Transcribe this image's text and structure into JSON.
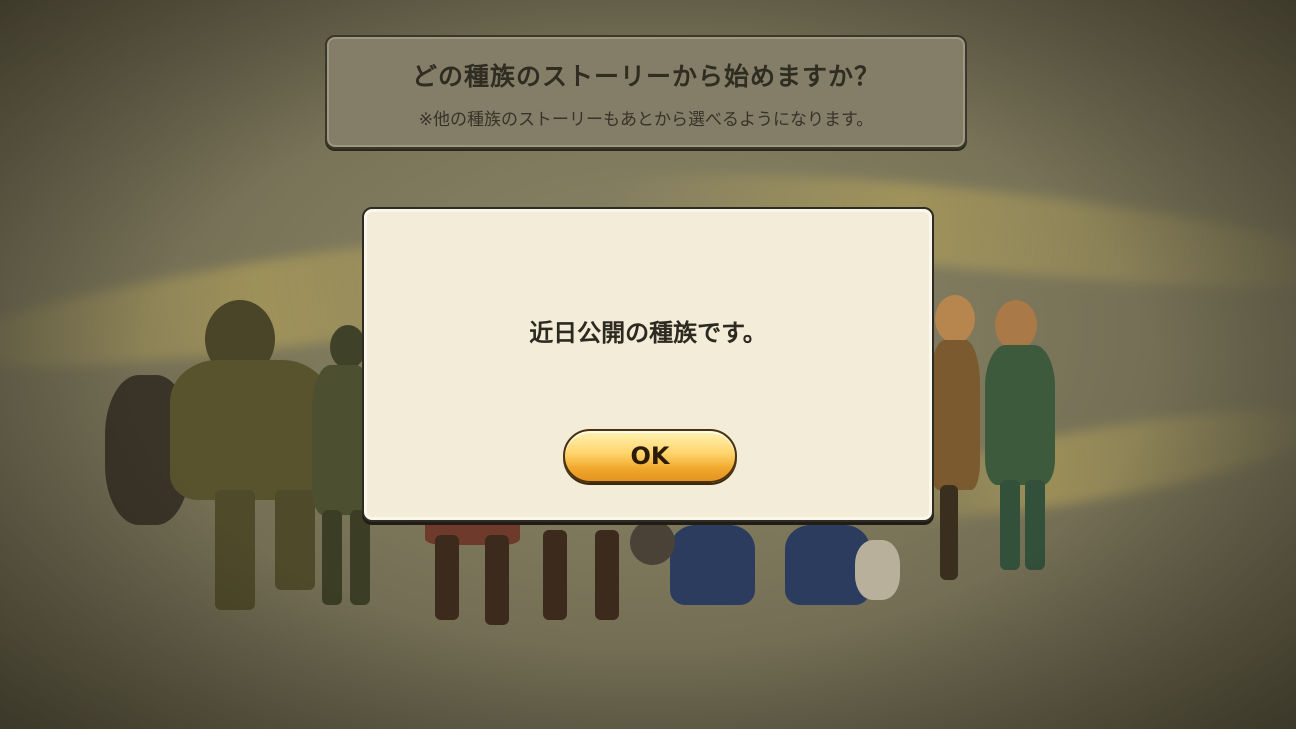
{
  "header": {
    "title": "どの種族のストーリーから始めますか？",
    "subtitle": "※他の種族のストーリーもあとから選べるようになります。"
  },
  "dialog": {
    "message": "近日公開の種族です。",
    "ok_label": "OK"
  },
  "colors": {
    "panel_bg": "#847e68",
    "dialog_bg": "#f2ecd8",
    "button_gold": "#ffd46b",
    "scene_bg": "#7a7459"
  }
}
